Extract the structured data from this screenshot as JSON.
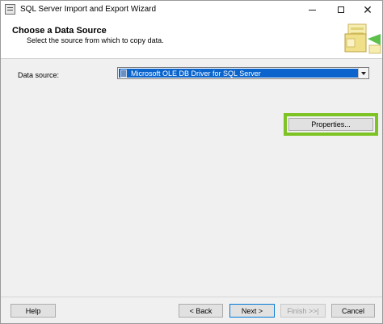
{
  "window": {
    "title": "SQL Server Import and Export Wizard"
  },
  "header": {
    "title": "Choose a Data Source",
    "subtitle": "Select the source from which to copy data."
  },
  "data_source": {
    "label": "Data source:",
    "selected": "Microsoft OLE DB Driver for SQL Server"
  },
  "buttons": {
    "properties": "Properties...",
    "help": "Help",
    "back": "< Back",
    "next": "Next >",
    "finish": "Finish >>|",
    "cancel": "Cancel"
  },
  "colors": {
    "highlight": "#7dc323",
    "selection": "#0a64cc"
  }
}
